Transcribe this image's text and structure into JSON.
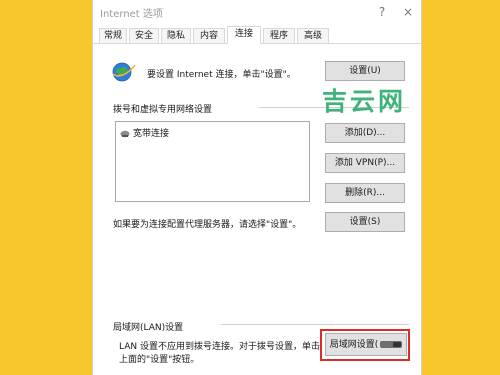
{
  "colors": {
    "background": "#F8C72B",
    "watermark": "#3fb37a",
    "highlight": "#e02a2a"
  },
  "window": {
    "title": "Internet 选项",
    "help": "?",
    "close": "×"
  },
  "tabs": [
    {
      "label": "常规"
    },
    {
      "label": "安全"
    },
    {
      "label": "隐私"
    },
    {
      "label": "内容"
    },
    {
      "label": "连接",
      "active": true
    },
    {
      "label": "程序"
    },
    {
      "label": "高级"
    }
  ],
  "setup": {
    "text": "要设置 Internet 连接，单击\"设置\"。",
    "button": "设置(U)",
    "icon": "globe-icon"
  },
  "dialup": {
    "heading": "拨号和虚拟专用网络设置",
    "items": [
      "宽带连接"
    ],
    "add": "添加(D)...",
    "add_vpn": "添加 VPN(P)...",
    "remove": "删除(R)...",
    "proxy_text": "如果要为连接配置代理服务器，请选择\"设置\"。",
    "settings": "设置(S)"
  },
  "lan": {
    "heading": "局域网(LAN)设置",
    "line1": "LAN 设置不应用到拨号连接。对于拨号设置，单击",
    "line2": "上面的\"设置\"按钮。",
    "button": "局域网设置("
  },
  "watermark": "吉云网"
}
